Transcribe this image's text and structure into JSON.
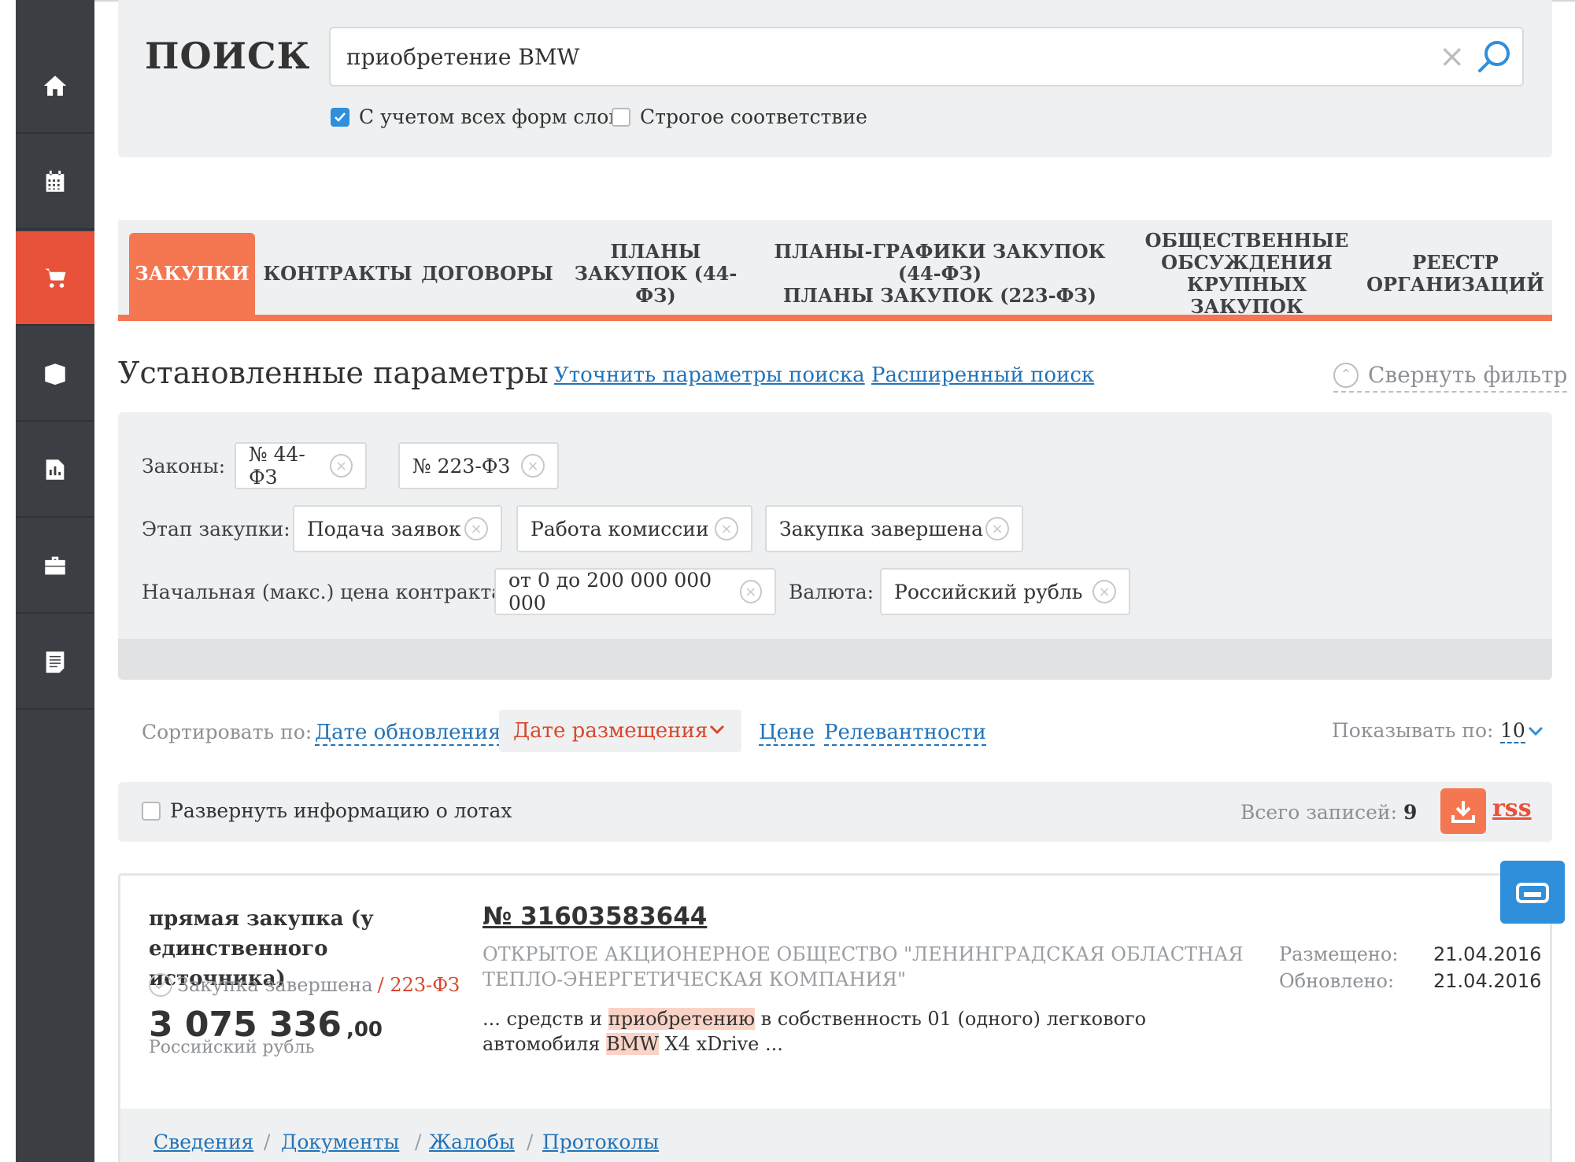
{
  "search": {
    "title": "ПОИСК",
    "query": "приобретение BMW",
    "opt_all_forms": "С учетом всех форм слов",
    "opt_all_forms_checked": true,
    "opt_strict": "Строгое соответствие",
    "opt_strict_checked": false
  },
  "sidebar": {
    "items": [
      {
        "icon": "home-icon"
      },
      {
        "icon": "calendar-icon"
      },
      {
        "icon": "cart-icon",
        "active": true
      },
      {
        "icon": "book-icon"
      },
      {
        "icon": "report-icon"
      },
      {
        "icon": "briefcase-icon"
      },
      {
        "icon": "document-icon"
      }
    ]
  },
  "tabs": [
    {
      "line1": "ЗАКУПКИ",
      "line2": "",
      "line3": "",
      "active": true
    },
    {
      "line1": "КОНТРАКТЫ",
      "line2": "",
      "line3": ""
    },
    {
      "line1": "ДОГОВОРЫ",
      "line2": "",
      "line3": ""
    },
    {
      "line1": "ПЛАНЫ",
      "line2": "ЗАКУПОК (44-ФЗ)",
      "line3": ""
    },
    {
      "line1": "ПЛАНЫ-ГРАФИКИ ЗАКУПОК (44-ФЗ)",
      "line2": "ПЛАНЫ ЗАКУПОК (223-ФЗ)",
      "line3": ""
    },
    {
      "line1": "ОБЩЕСТВЕННЫЕ",
      "line2": "ОБСУЖДЕНИЯ",
      "line3": "КРУПНЫХ ЗАКУПОК"
    },
    {
      "line1": "РЕЕСТР",
      "line2": "ОРГАНИЗАЦИЙ",
      "line3": ""
    }
  ],
  "params": {
    "title": "Установленные параметры",
    "refine_link": "Уточнить параметры поиска",
    "advanced_link": "Расширенный поиск",
    "collapse": "Свернуть фильтр"
  },
  "filters": {
    "laws_label": "Законы:",
    "laws": [
      "№ 44-ФЗ",
      "№ 223-ФЗ"
    ],
    "stage_label": "Этап закупки:",
    "stages": [
      "Подача заявок",
      "Работа комиссии",
      "Закупка завершена"
    ],
    "price_label": "Начальная (макс.) цена контракта:",
    "price": "от 0 до 200 000 000 000",
    "currency_label": "Валюта:",
    "currency": "Российский рубль"
  },
  "sort": {
    "label": "Сортировать по:",
    "update": "Дате обновления",
    "placement": "Дате размещения",
    "price": "Цене",
    "relevance": "Релевантности",
    "show_label": "Показывать по:",
    "show_value": "10"
  },
  "info": {
    "expand": "Развернуть информацию о лотах",
    "total_label": "Всего записей:",
    "total": "9",
    "rss": "rss"
  },
  "card": {
    "type": "прямая закупка (у единственного источника)",
    "status": "Закупка завершена",
    "law": "223-ФЗ",
    "price_main": "3 075 336",
    "price_cents": ",00",
    "currency": "Российский рубль",
    "number": "№ 31603583644",
    "org": "ОТКРЫТОЕ АКЦИОНЕРНОЕ ОБЩЕСТВО \"ЛЕНИНГРАДСКАЯ ОБЛАСТНАЯ ТЕПЛО-ЭНЕРГЕТИЧЕСКАЯ КОМПАНИЯ\"",
    "snippet_1": "... средств и ",
    "snippet_hl1": "приобретению",
    "snippet_2": " в собственность 01 (одного) легкового автомобиля ",
    "snippet_hl2": "BMW",
    "snippet_3": " X4 xDrive ...",
    "placed_label": "Размещено:",
    "placed": "21.04.2016",
    "updated_label": "Обновлено:",
    "updated": "21.04.2016",
    "links": [
      "Сведения",
      "Документы",
      "Жалобы",
      "Протоколы"
    ]
  }
}
